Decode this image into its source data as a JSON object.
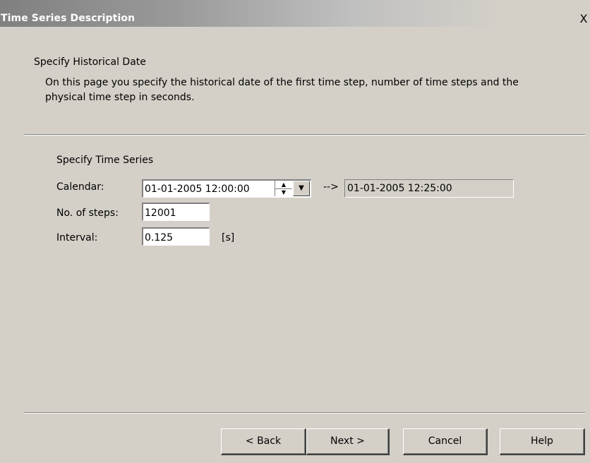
{
  "window": {
    "title": "Time Series Description",
    "close_label": "X"
  },
  "header": {
    "title": "Specify Historical Date",
    "description": "On this page you specify the historical date of the first time step, number of time steps and the physical time step in seconds."
  },
  "group": {
    "title": "Specify Time Series"
  },
  "fields": {
    "calendar_label": "Calendar:",
    "calendar_value": "01-01-2005 12:00:00",
    "arrow": "-->",
    "end_value": "01-01-2005 12:25:00",
    "steps_label": "No. of steps:",
    "steps_value": "12001",
    "interval_label": "Interval:",
    "interval_value": "0.125",
    "interval_unit": "[s]"
  },
  "icons": {
    "spin_up": "triangle-up",
    "spin_down": "triangle-down",
    "dropdown": "chevron-down"
  },
  "buttons": {
    "back": "< Back",
    "next": "Next >",
    "cancel": "Cancel",
    "help": "Help"
  },
  "colors": {
    "dialog_bg": "#d4d0c8",
    "title_text": "#ffffff"
  }
}
